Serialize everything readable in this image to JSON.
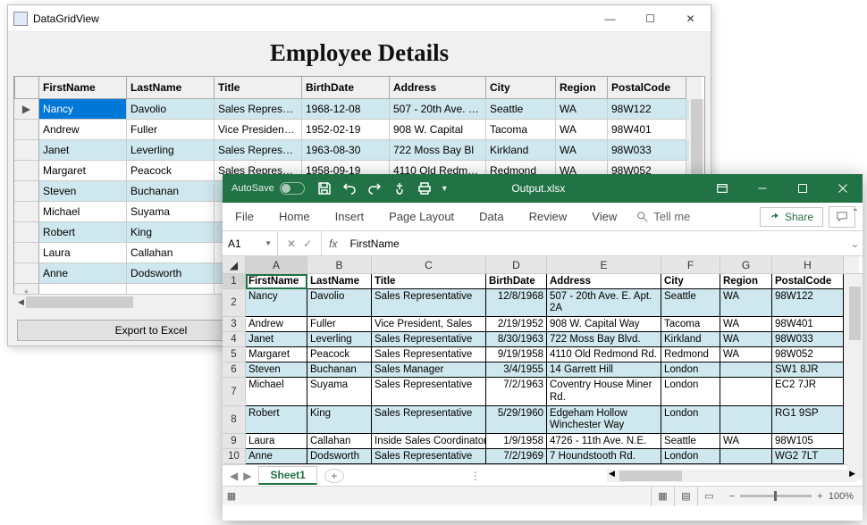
{
  "winform": {
    "title": "DataGridView",
    "heading": "Employee Details",
    "export_label": "Export to Excel",
    "row_indicator": "▶",
    "columns": [
      "FirstName",
      "LastName",
      "Title",
      "BirthDate",
      "Address",
      "City",
      "Region",
      "PostalCode"
    ],
    "rows": [
      {
        "FirstName": "Nancy",
        "LastName": "Davolio",
        "Title": "Sales Represent...",
        "BirthDate": "1968-12-08",
        "Address": "507 - 20th Ave. E...",
        "City": "Seattle",
        "Region": "WA",
        "PostalCode": "98W122"
      },
      {
        "FirstName": "Andrew",
        "LastName": "Fuller",
        "Title": "Vice President, S...",
        "BirthDate": "1952-02-19",
        "Address": "908 W. Capital",
        "City": "Tacoma",
        "Region": "WA",
        "PostalCode": "98W401"
      },
      {
        "FirstName": "Janet",
        "LastName": "Leverling",
        "Title": "Sales Represent...",
        "BirthDate": "1963-08-30",
        "Address": "722 Moss Bay Bl",
        "City": "Kirkland",
        "Region": "WA",
        "PostalCode": "98W033"
      },
      {
        "FirstName": "Margaret",
        "LastName": "Peacock",
        "Title": "Sales Represent...",
        "BirthDate": "1958-09-19",
        "Address": "4110 Old Redmo...",
        "City": "Redmond",
        "Region": "WA",
        "PostalCode": "98W052"
      },
      {
        "FirstName": "Steven",
        "LastName": "Buchanan",
        "Title": "",
        "BirthDate": "",
        "Address": "",
        "City": "",
        "Region": "",
        "PostalCode": ""
      },
      {
        "FirstName": "Michael",
        "LastName": "Suyama",
        "Title": "",
        "BirthDate": "",
        "Address": "",
        "City": "",
        "Region": "",
        "PostalCode": ""
      },
      {
        "FirstName": "Robert",
        "LastName": "King",
        "Title": "",
        "BirthDate": "",
        "Address": "",
        "City": "",
        "Region": "",
        "PostalCode": ""
      },
      {
        "FirstName": "Laura",
        "LastName": "Callahan",
        "Title": "",
        "BirthDate": "",
        "Address": "",
        "City": "",
        "Region": "",
        "PostalCode": ""
      },
      {
        "FirstName": "Anne",
        "LastName": "Dodsworth",
        "Title": "",
        "BirthDate": "",
        "Address": "",
        "City": "",
        "Region": "",
        "PostalCode": ""
      }
    ]
  },
  "excel": {
    "autosave": "AutoSave",
    "filename": "Output.xlsx",
    "tabs": [
      "File",
      "Home",
      "Insert",
      "Page Layout",
      "Data",
      "Review",
      "View"
    ],
    "tellme": "Tell me",
    "share": "Share",
    "namebox": "A1",
    "fx": "fx",
    "fx_value": "FirstName",
    "cols": [
      "A",
      "B",
      "C",
      "D",
      "E",
      "F",
      "G",
      "H"
    ],
    "header_row": [
      "FirstName",
      "LastName",
      "Title",
      "BirthDate",
      "Address",
      "City",
      "Region",
      "PostalCode"
    ],
    "rows": [
      {
        "n": 2,
        "alt": true,
        "c": [
          "Nancy",
          "Davolio",
          "Sales Representative",
          "12/8/1968",
          "507 - 20th Ave. E. Apt. 2A",
          "Seattle",
          "WA",
          "98W122"
        ],
        "wrap": true
      },
      {
        "n": 3,
        "alt": false,
        "c": [
          "Andrew",
          "Fuller",
          "Vice President, Sales",
          "2/19/1952",
          "908 W. Capital Way",
          "Tacoma",
          "WA",
          "98W401"
        ]
      },
      {
        "n": 4,
        "alt": true,
        "c": [
          "Janet",
          "Leverling",
          "Sales Representative",
          "8/30/1963",
          "722 Moss Bay Blvd.",
          "Kirkland",
          "WA",
          "98W033"
        ]
      },
      {
        "n": 5,
        "alt": false,
        "c": [
          "Margaret",
          "Peacock",
          "Sales Representative",
          "9/19/1958",
          "4110 Old Redmond Rd.",
          "Redmond",
          "WA",
          "98W052"
        ]
      },
      {
        "n": 6,
        "alt": true,
        "c": [
          "Steven",
          "Buchanan",
          "Sales Manager",
          "3/4/1955",
          "14 Garrett Hill",
          "London",
          "",
          "SW1 8JR"
        ]
      },
      {
        "n": 7,
        "alt": false,
        "c": [
          "Michael",
          "Suyama",
          "Sales Representative",
          "7/2/1963",
          "Coventry House Miner Rd.",
          "London",
          "",
          "EC2 7JR"
        ],
        "wrap": true
      },
      {
        "n": 8,
        "alt": true,
        "c": [
          "Robert",
          "King",
          "Sales Representative",
          "5/29/1960",
          "Edgeham Hollow Winchester Way",
          "London",
          "",
          "RG1 9SP"
        ],
        "wrap": true
      },
      {
        "n": 9,
        "alt": false,
        "c": [
          "Laura",
          "Callahan",
          "Inside Sales Coordinator",
          "1/9/1958",
          "4726 - 11th Ave. N.E.",
          "Seattle",
          "WA",
          "98W105"
        ]
      },
      {
        "n": 10,
        "alt": true,
        "c": [
          "Anne",
          "Dodsworth",
          "Sales Representative",
          "7/2/1969",
          "7 Houndstooth Rd.",
          "London",
          "",
          "WG2 7LT"
        ]
      }
    ],
    "sheet_tab": "Sheet1",
    "zoom": "100%"
  }
}
